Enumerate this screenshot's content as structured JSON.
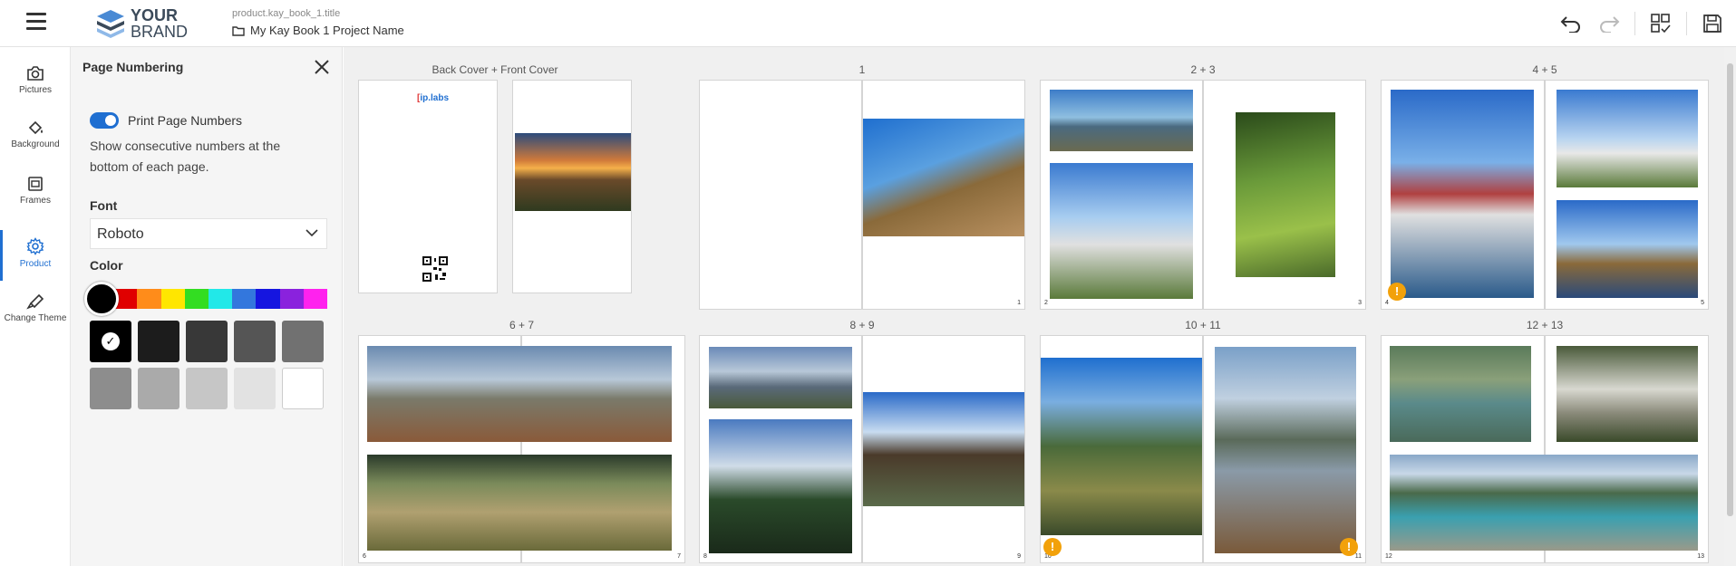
{
  "header": {
    "logo_line1": "YOUR",
    "logo_line2": "BRAND",
    "project_key": "product.kay_book_1.title",
    "project_name": "My Kay Book 1 Project Name"
  },
  "rail": [
    {
      "label": "Pictures",
      "icon": "camera-icon"
    },
    {
      "label": "Background",
      "icon": "paint-bucket-icon"
    },
    {
      "label": "Frames",
      "icon": "frame-icon"
    },
    {
      "label": "Product",
      "icon": "gear-icon"
    },
    {
      "label": "Change Theme",
      "icon": "brush-icon"
    }
  ],
  "panel": {
    "title": "Page Numbering",
    "toggle_label": "Print Page Numbers",
    "toggle_on": true,
    "description": "Show consecutive numbers at the bottom of each page.",
    "font_label": "Font",
    "font_value": "Roboto",
    "color_label": "Color",
    "spectrum": [
      "#8b0000",
      "#e00000",
      "#ff8c1a",
      "#ffe600",
      "#33dd22",
      "#22e8e8",
      "#3377dd",
      "#1515e0",
      "#8a22dd",
      "#ff22ee"
    ],
    "swatches": [
      "#000000",
      "#1c1c1c",
      "#383838",
      "#555555",
      "#717171",
      "#8d8d8d",
      "#aaaaaa",
      "#c6c6c6",
      "#e2e2e2",
      "#ffffff"
    ],
    "selected_swatch": 0
  },
  "spreads": [
    {
      "label": "Back Cover + Front Cover",
      "left_num": "",
      "right_num": "",
      "logo_text": "ip.labs"
    },
    {
      "label": "1",
      "left_num": "",
      "right_num": "1"
    },
    {
      "label": "2 + 3",
      "left_num": "2",
      "right_num": "3"
    },
    {
      "label": "4 + 5",
      "left_num": "4",
      "right_num": "5"
    },
    {
      "label": "6 + 7",
      "left_num": "6",
      "right_num": "7"
    },
    {
      "label": "8 + 9",
      "left_num": "8",
      "right_num": "9"
    },
    {
      "label": "10 + 11",
      "left_num": "10",
      "right_num": "11"
    },
    {
      "label": "12 + 13",
      "left_num": "12",
      "right_num": "13"
    }
  ],
  "warning_glyph": "!"
}
